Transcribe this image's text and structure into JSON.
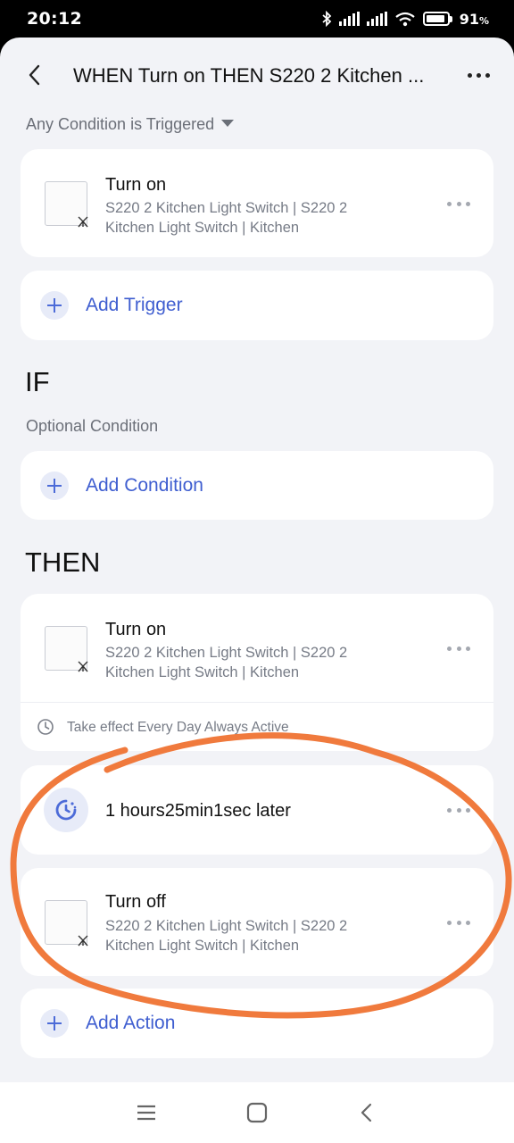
{
  "status_bar": {
    "time": "20:12",
    "battery_percent": "91",
    "battery_unit": "%",
    "battery_level": 0.91,
    "icons": [
      "bluetooth-icon",
      "signal-icon",
      "signal-icon",
      "wifi-icon",
      "battery-icon"
    ]
  },
  "header": {
    "title": "WHEN Turn on THEN S220 2 Kitchen ...",
    "back_icon": "back-chevron-icon",
    "more_icon": "more-dots-icon"
  },
  "when": {
    "match_mode": "Any Condition is Triggered",
    "triggers": [
      {
        "title": "Turn on",
        "subtitle": "S220 2 Kitchen Light Switch | S220 2 Kitchen Light Switch | Kitchen",
        "icon": "light-switch-device-icon"
      }
    ],
    "add_label": "Add Trigger"
  },
  "if": {
    "heading": "IF",
    "hint": "Optional Condition",
    "add_label": "Add Condition"
  },
  "then": {
    "heading": "THEN",
    "actions": [
      {
        "title": "Turn on",
        "subtitle": "S220 2 Kitchen Light Switch | S220 2 Kitchen Light Switch | Kitchen",
        "icon": "light-switch-device-icon",
        "effect": "Take effect Every Day Always Active"
      },
      {
        "title": "1 hours25min1sec later",
        "icon": "delay-timer-icon"
      },
      {
        "title": "Turn off",
        "subtitle": "S220 2 Kitchen Light Switch | S220 2 Kitchen Light Switch | Kitchen",
        "icon": "light-switch-device-icon"
      }
    ],
    "add_label": "Add Action"
  },
  "annotation_color": "#f07a3d",
  "accent_color": "#3f5ed0",
  "nav_bar": [
    "menu-icon",
    "home-square-icon",
    "back-icon"
  ]
}
